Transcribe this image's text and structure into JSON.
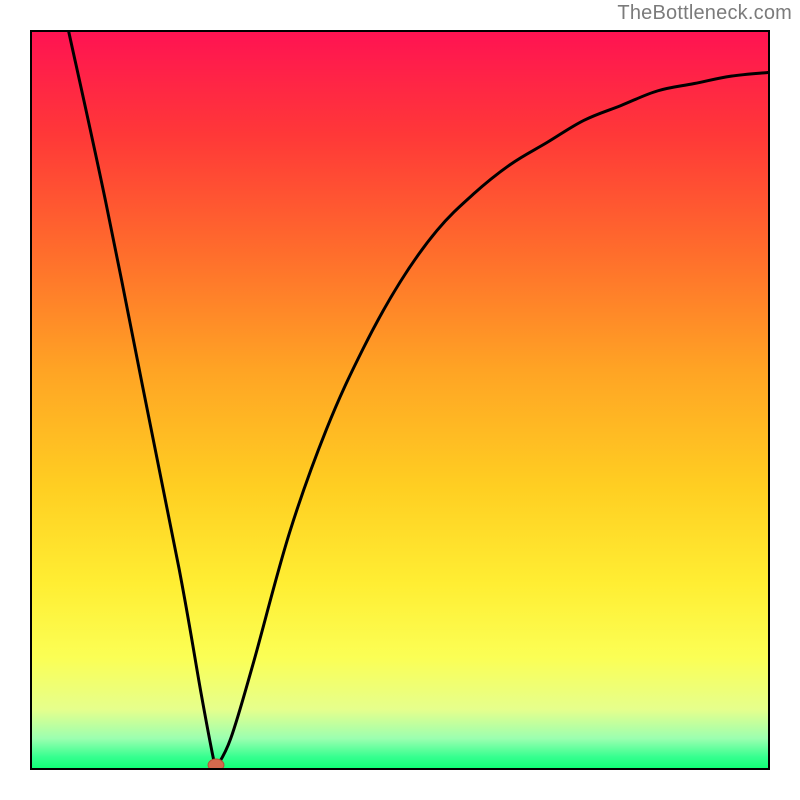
{
  "attribution": "TheBottleneck.com",
  "colors": {
    "frame_border": "#000000",
    "curve": "#000000",
    "marker_fill": "#d46a4e",
    "marker_stroke": "#b84f34",
    "gradient_stops": [
      {
        "stop": 0.0,
        "hex": "#ff1352"
      },
      {
        "stop": 0.14,
        "hex": "#ff3838"
      },
      {
        "stop": 0.3,
        "hex": "#ff6d2c"
      },
      {
        "stop": 0.46,
        "hex": "#ffa424"
      },
      {
        "stop": 0.62,
        "hex": "#ffcf22"
      },
      {
        "stop": 0.75,
        "hex": "#ffee33"
      },
      {
        "stop": 0.85,
        "hex": "#fbff55"
      },
      {
        "stop": 0.92,
        "hex": "#e6ff8c"
      },
      {
        "stop": 0.96,
        "hex": "#9bffb0"
      },
      {
        "stop": 0.985,
        "hex": "#36ff8f"
      },
      {
        "stop": 1.0,
        "hex": "#11ff77"
      }
    ]
  },
  "chart_data": {
    "type": "line",
    "title": "",
    "xlabel": "",
    "ylabel": "",
    "xlim": [
      0,
      1
    ],
    "ylim": [
      0,
      1
    ],
    "marker": {
      "x": 0.25,
      "y": 0.0
    },
    "left_branch": [
      {
        "x": 0.05,
        "y": 1.0
      },
      {
        "x": 0.1,
        "y": 0.77
      },
      {
        "x": 0.15,
        "y": 0.52
      },
      {
        "x": 0.2,
        "y": 0.27
      },
      {
        "x": 0.23,
        "y": 0.1
      },
      {
        "x": 0.245,
        "y": 0.02
      },
      {
        "x": 0.25,
        "y": 0.0
      }
    ],
    "right_branch": [
      {
        "x": 0.25,
        "y": 0.0
      },
      {
        "x": 0.27,
        "y": 0.04
      },
      {
        "x": 0.3,
        "y": 0.14
      },
      {
        "x": 0.35,
        "y": 0.32
      },
      {
        "x": 0.4,
        "y": 0.46
      },
      {
        "x": 0.45,
        "y": 0.57
      },
      {
        "x": 0.5,
        "y": 0.66
      },
      {
        "x": 0.55,
        "y": 0.73
      },
      {
        "x": 0.6,
        "y": 0.78
      },
      {
        "x": 0.65,
        "y": 0.82
      },
      {
        "x": 0.7,
        "y": 0.85
      },
      {
        "x": 0.75,
        "y": 0.88
      },
      {
        "x": 0.8,
        "y": 0.9
      },
      {
        "x": 0.85,
        "y": 0.92
      },
      {
        "x": 0.9,
        "y": 0.93
      },
      {
        "x": 0.95,
        "y": 0.94
      },
      {
        "x": 1.0,
        "y": 0.945
      }
    ]
  }
}
